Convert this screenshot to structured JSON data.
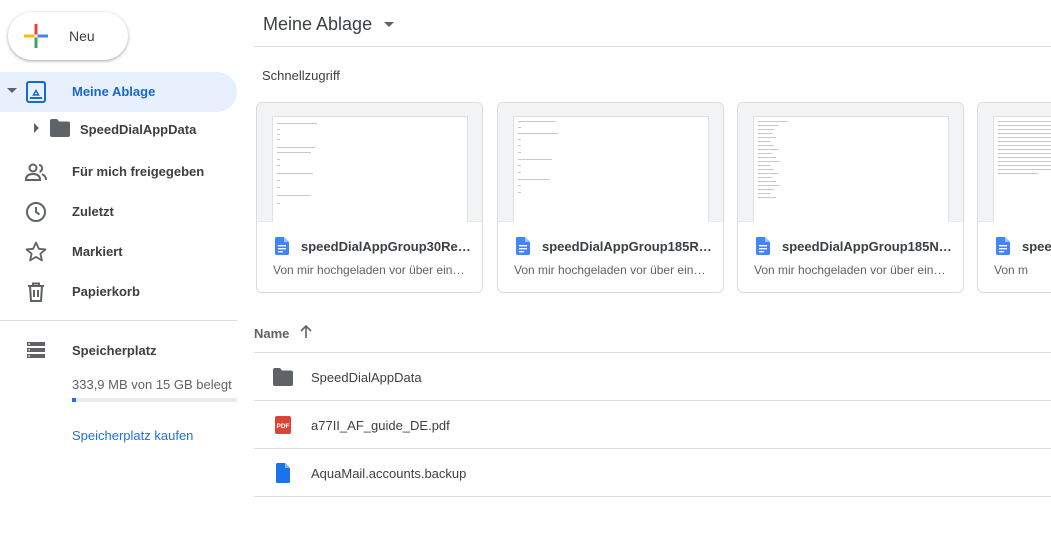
{
  "sidebar": {
    "new_label": "Neu",
    "my_drive": "Meine Ablage",
    "tree_folder": "SpeedDialAppData",
    "shared": "Für mich freigegeben",
    "recent": "Zuletzt",
    "starred": "Markiert",
    "trash": "Papierkorb",
    "storage_title": "Speicherplatz",
    "storage_used": "333,9 MB von 15 GB belegt",
    "storage_fraction": 0.022,
    "buy_storage": "Speicherplatz kaufen"
  },
  "main": {
    "title": "Meine Ablage",
    "quick_access_title": "Schnellzugriff",
    "quick_access": [
      {
        "name": "speedDialAppGroup30Re…",
        "subtitle": "Von mir hochgeladen vor über ein…"
      },
      {
        "name": "speedDialAppGroup185Re…",
        "subtitle": "Von mir hochgeladen vor über ein…"
      },
      {
        "name": "speedDialAppGroup185Na…",
        "subtitle": "Von mir hochgeladen vor über ein…"
      },
      {
        "name": "spee",
        "subtitle": "Von m"
      }
    ],
    "list_header_name": "Name",
    "files": [
      {
        "name": "SpeedDialAppData",
        "type": "folder-icon"
      },
      {
        "name": "a77II_AF_guide_DE.pdf",
        "type": "pdf-icon"
      },
      {
        "name": "AquaMail.accounts.backup",
        "type": "document-icon"
      }
    ]
  },
  "colors": {
    "accent": "#1a73e8",
    "active_bg": "#e8f0fe",
    "active_text": "#1967d2",
    "pdf_red": "#db4437",
    "text": "#3c4043"
  }
}
